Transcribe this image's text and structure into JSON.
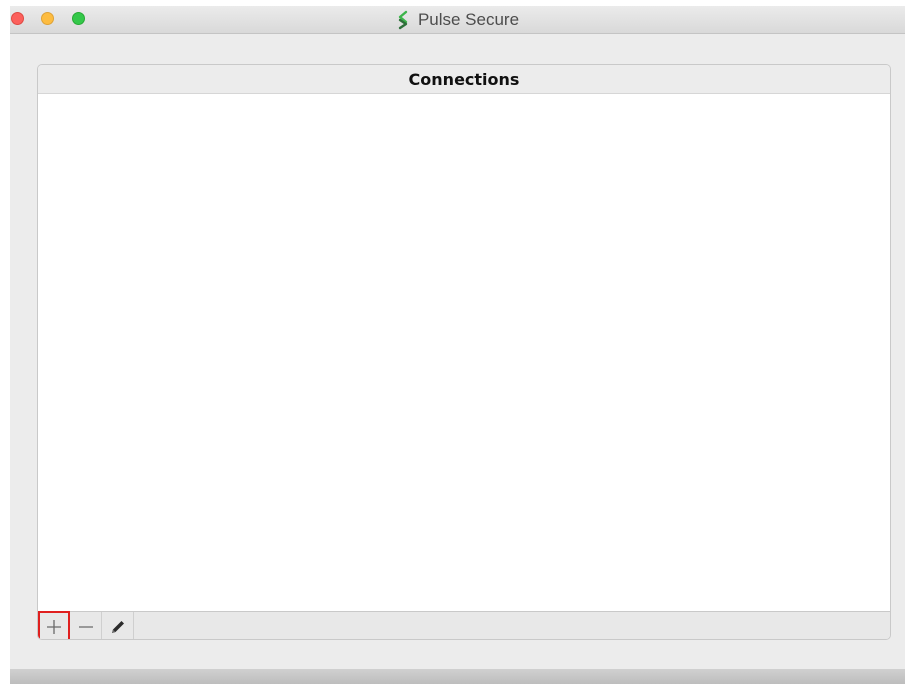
{
  "window": {
    "title": "Pulse Secure",
    "app_icon": "pulse-secure-s-icon",
    "traffic_lights": {
      "close_color": "#fc605c",
      "minimize_color": "#fdbc40",
      "zoom_color": "#34c84a"
    }
  },
  "connections_panel": {
    "title": "Connections",
    "items": []
  },
  "toolbar": {
    "buttons": [
      {
        "name": "add",
        "icon": "plus-icon",
        "highlighted": true,
        "highlight_color": "#e0201f"
      },
      {
        "name": "remove",
        "icon": "minus-icon"
      },
      {
        "name": "edit",
        "icon": "pencil-icon"
      }
    ]
  }
}
